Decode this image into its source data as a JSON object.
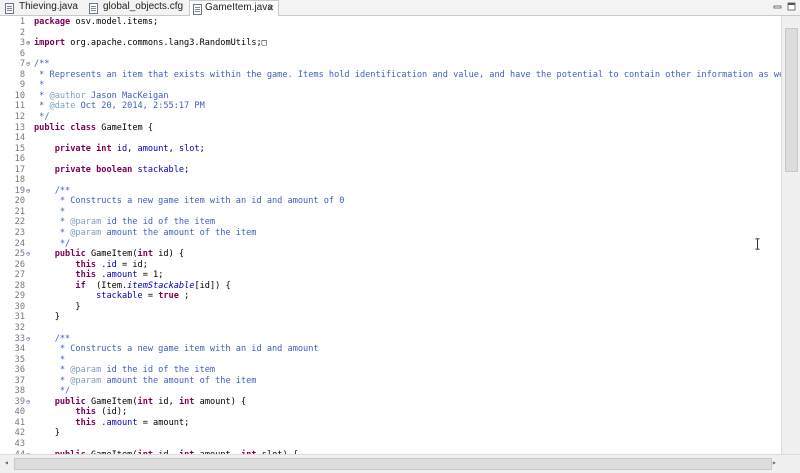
{
  "tabs": [
    {
      "label": "Thieving.java",
      "active": false
    },
    {
      "label": "global_objects.cfg",
      "active": false
    },
    {
      "label": "GameItem.java",
      "active": true,
      "close": "✕"
    }
  ],
  "tab_controls": [
    "minimize-icon",
    "maximize-icon"
  ],
  "editor": {
    "lines": [
      {
        "num": "1",
        "fold": "",
        "tokens": [
          [
            "k",
            "package"
          ],
          [
            "",
            "osv.model.items;"
          ]
        ]
      },
      {
        "num": "2",
        "fold": "",
        "tokens": []
      },
      {
        "num": "3",
        "fold": "⊕",
        "tokens": [
          [
            "k",
            "import"
          ],
          [
            "",
            "org.apache.commons.lang3.RandomUtils;"
          ],
          [
            "",
            "□"
          ]
        ]
      },
      {
        "num": "6",
        "fold": "",
        "tokens": []
      },
      {
        "num": "7",
        "fold": "⊖",
        "tokens": [
          [
            "c",
            "/**"
          ]
        ]
      },
      {
        "num": "8",
        "fold": "",
        "tokens": [
          [
            "c",
            " * Represents an item that exists within the game. Items hold identification and value, and have the potential to contain other information as well."
          ]
        ]
      },
      {
        "num": "9",
        "fold": "",
        "tokens": [
          [
            "c",
            " *"
          ]
        ]
      },
      {
        "num": "10",
        "fold": "",
        "tokens": [
          [
            "c",
            " * "
          ],
          [
            "tag",
            "@author"
          ],
          [
            "c",
            " Jason MacKeigan"
          ]
        ]
      },
      {
        "num": "11",
        "fold": "",
        "tokens": [
          [
            "c",
            " * "
          ],
          [
            "tag",
            "@date"
          ],
          [
            "c",
            " Oct 20, 2014, 2:55:17 PM"
          ]
        ]
      },
      {
        "num": "12",
        "fold": "",
        "tokens": [
          [
            "c",
            " */"
          ]
        ]
      },
      {
        "num": "13",
        "fold": "",
        "tokens": [
          [
            "k",
            "public class"
          ],
          [
            "",
            "GameItem {"
          ]
        ]
      },
      {
        "num": "14",
        "fold": "",
        "tokens": []
      },
      {
        "num": "15",
        "fold": "",
        "tokens": [
          [
            "",
            "    "
          ],
          [
            "k",
            "private int"
          ],
          [
            "f",
            "id"
          ],
          [
            "",
            ", "
          ],
          [
            "f",
            "amount"
          ],
          [
            "",
            ", "
          ],
          [
            "f",
            "slot"
          ],
          [
            "",
            ";"
          ]
        ]
      },
      {
        "num": "16",
        "fold": "",
        "tokens": []
      },
      {
        "num": "17",
        "fold": "",
        "tokens": [
          [
            "",
            "    "
          ],
          [
            "k",
            "private boolean"
          ],
          [
            "f",
            "stackable"
          ],
          [
            "",
            ";"
          ]
        ]
      },
      {
        "num": "18",
        "fold": "",
        "tokens": []
      },
      {
        "num": "19",
        "fold": "⊖",
        "tokens": [
          [
            "c",
            "    /**"
          ]
        ]
      },
      {
        "num": "20",
        "fold": "",
        "tokens": [
          [
            "c",
            "     * Constructs a new game item with an id and amount of 0"
          ]
        ]
      },
      {
        "num": "21",
        "fold": "",
        "tokens": [
          [
            "c",
            "     *"
          ]
        ]
      },
      {
        "num": "22",
        "fold": "",
        "tokens": [
          [
            "c",
            "     * "
          ],
          [
            "tag",
            "@param"
          ],
          [
            "c",
            " id the id of the item"
          ]
        ]
      },
      {
        "num": "23",
        "fold": "",
        "tokens": [
          [
            "c",
            "     * "
          ],
          [
            "tag",
            "@param"
          ],
          [
            "c",
            " amount the amount of the item"
          ]
        ]
      },
      {
        "num": "24",
        "fold": "",
        "tokens": [
          [
            "c",
            "     */"
          ]
        ]
      },
      {
        "num": "25",
        "fold": "⊖",
        "tokens": [
          [
            "",
            "    "
          ],
          [
            "k",
            "public"
          ],
          [
            "",
            "GameItem("
          ],
          [
            "k",
            "int"
          ],
          [
            "",
            "id) {"
          ]
        ]
      },
      {
        "num": "26",
        "fold": "",
        "tokens": [
          [
            "",
            "        "
          ],
          [
            "k",
            "this"
          ],
          [
            "",
            "."
          ],
          [
            "f",
            "id"
          ],
          [
            "",
            " = id;"
          ]
        ]
      },
      {
        "num": "27",
        "fold": "",
        "tokens": [
          [
            "",
            "        "
          ],
          [
            "k",
            "this"
          ],
          [
            "",
            "."
          ],
          [
            "f",
            "amount"
          ],
          [
            "",
            " = 1;"
          ]
        ]
      },
      {
        "num": "28",
        "fold": "",
        "tokens": [
          [
            "",
            "        "
          ],
          [
            "k",
            "if"
          ],
          [
            "",
            " (Item."
          ],
          [
            "fi",
            "itemStackable"
          ],
          [
            "",
            "[id]) {"
          ]
        ]
      },
      {
        "num": "29",
        "fold": "",
        "tokens": [
          [
            "",
            "            "
          ],
          [
            "f",
            "stackable"
          ],
          [
            "",
            " = "
          ],
          [
            "k",
            "true"
          ],
          [
            "",
            ";"
          ]
        ]
      },
      {
        "num": "30",
        "fold": "",
        "tokens": [
          [
            "",
            "        }"
          ]
        ]
      },
      {
        "num": "31",
        "fold": "",
        "tokens": [
          [
            "",
            "    }"
          ]
        ]
      },
      {
        "num": "32",
        "fold": "",
        "tokens": []
      },
      {
        "num": "33",
        "fold": "⊖",
        "tokens": [
          [
            "c",
            "    /**"
          ]
        ]
      },
      {
        "num": "34",
        "fold": "",
        "tokens": [
          [
            "c",
            "     * Constructs a new game item with an id and amount"
          ]
        ]
      },
      {
        "num": "35",
        "fold": "",
        "tokens": [
          [
            "c",
            "     *"
          ]
        ]
      },
      {
        "num": "36",
        "fold": "",
        "tokens": [
          [
            "c",
            "     * "
          ],
          [
            "tag",
            "@param"
          ],
          [
            "c",
            " id the id of the item"
          ]
        ]
      },
      {
        "num": "37",
        "fold": "",
        "tokens": [
          [
            "c",
            "     * "
          ],
          [
            "tag",
            "@param"
          ],
          [
            "c",
            " amount the amount of the item"
          ]
        ]
      },
      {
        "num": "38",
        "fold": "",
        "tokens": [
          [
            "c",
            "     */"
          ]
        ]
      },
      {
        "num": "39",
        "fold": "⊖",
        "tokens": [
          [
            "",
            "    "
          ],
          [
            "k",
            "public"
          ],
          [
            "",
            "GameItem("
          ],
          [
            "k",
            "int"
          ],
          [
            "",
            "id, "
          ],
          [
            "k",
            "int"
          ],
          [
            "",
            "amount) {"
          ]
        ]
      },
      {
        "num": "40",
        "fold": "",
        "tokens": [
          [
            "",
            "        "
          ],
          [
            "k",
            "this"
          ],
          [
            "",
            "(id);"
          ]
        ]
      },
      {
        "num": "41",
        "fold": "",
        "tokens": [
          [
            "",
            "        "
          ],
          [
            "k",
            "this"
          ],
          [
            "",
            "."
          ],
          [
            "f",
            "amount"
          ],
          [
            "",
            " = amount;"
          ]
        ]
      },
      {
        "num": "42",
        "fold": "",
        "tokens": [
          [
            "",
            "    }"
          ]
        ]
      },
      {
        "num": "43",
        "fold": "",
        "tokens": []
      },
      {
        "num": "44",
        "fold": "⊖",
        "tokens": [
          [
            "",
            "    "
          ],
          [
            "k",
            "public"
          ],
          [
            "",
            "GameItem("
          ],
          [
            "k",
            "int"
          ],
          [
            "",
            "id, "
          ],
          [
            "k",
            "int"
          ],
          [
            "",
            "amount, "
          ],
          [
            "k",
            "int"
          ],
          [
            "",
            "slot) {"
          ]
        ]
      }
    ]
  }
}
